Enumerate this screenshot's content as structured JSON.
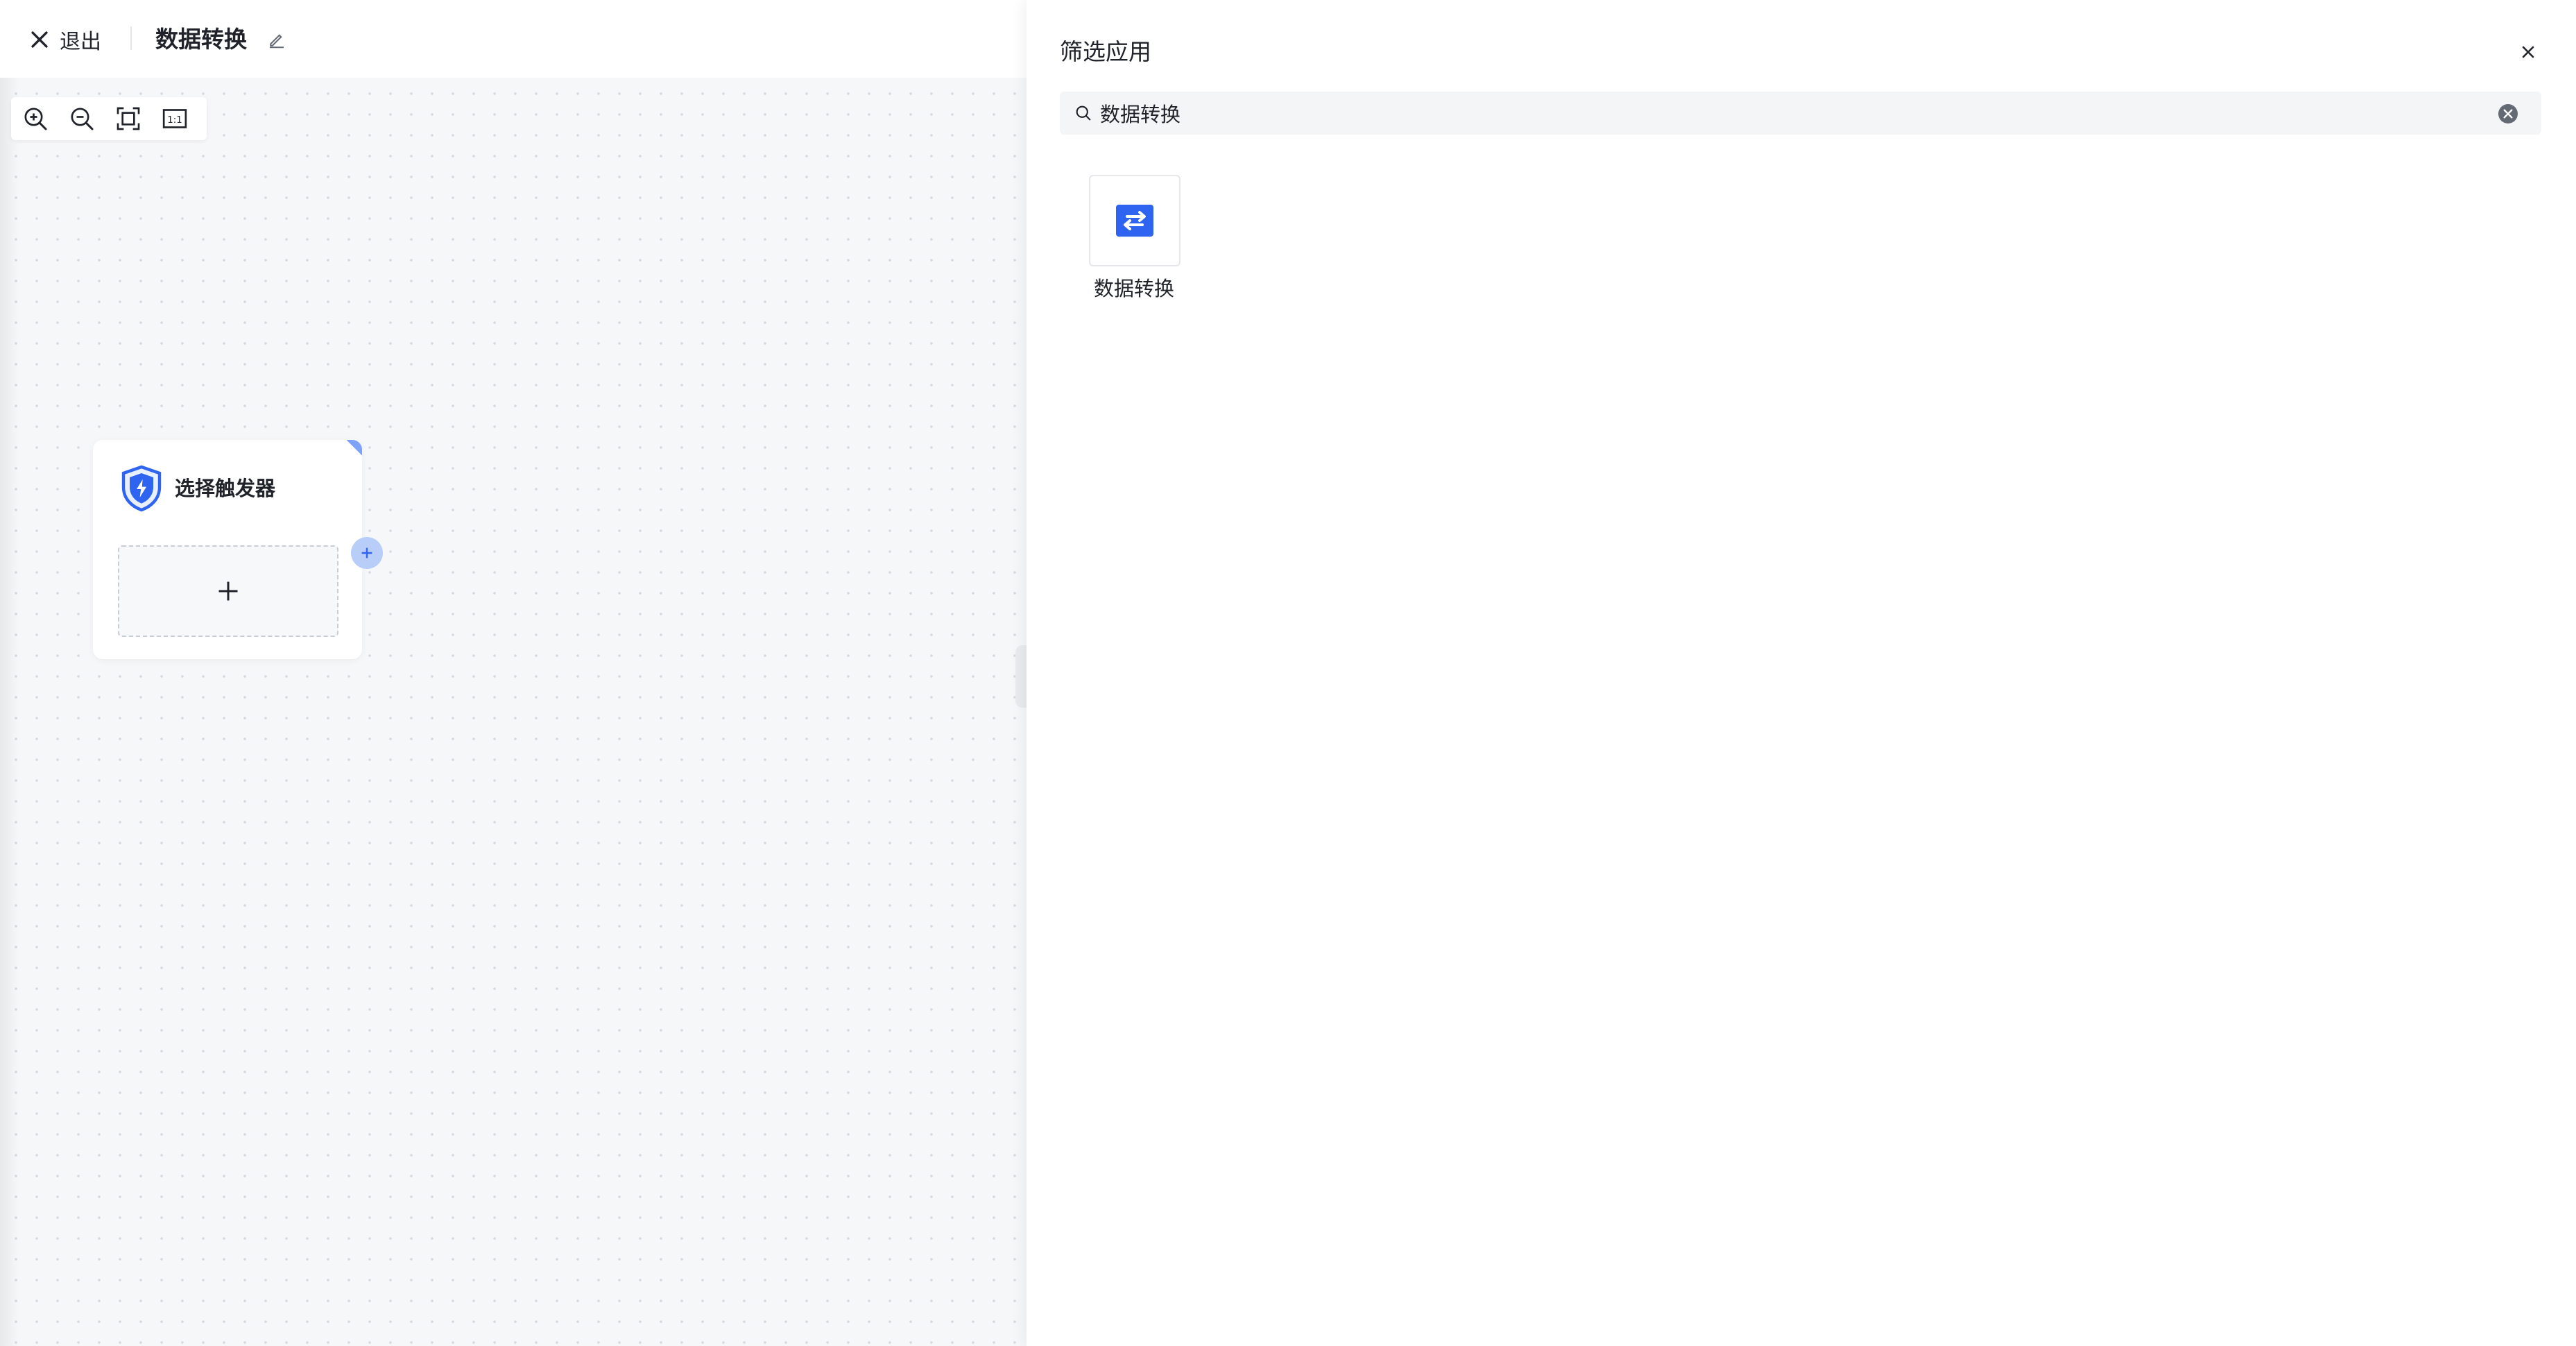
{
  "header": {
    "exit_label": "退出",
    "title": "数据转换"
  },
  "zoom_toolbar": {
    "buttons": [
      "zoom-in-icon",
      "zoom-out-icon",
      "fit-screen-icon",
      "actual-size-icon"
    ],
    "actual_size_label": "1:1"
  },
  "trigger_node": {
    "title": "选择触发器",
    "icon": "shield-icon",
    "add_icon": "plus-icon"
  },
  "drawer": {
    "title": "筛选应用",
    "search_value": "数据转换",
    "results": [
      {
        "label": "数据转换",
        "icon": "swap-arrows-icon"
      }
    ]
  },
  "colors": {
    "accent": "#2f64f0",
    "node_corner": "#7ea2f7",
    "node_plus": "#b8cdf8"
  }
}
